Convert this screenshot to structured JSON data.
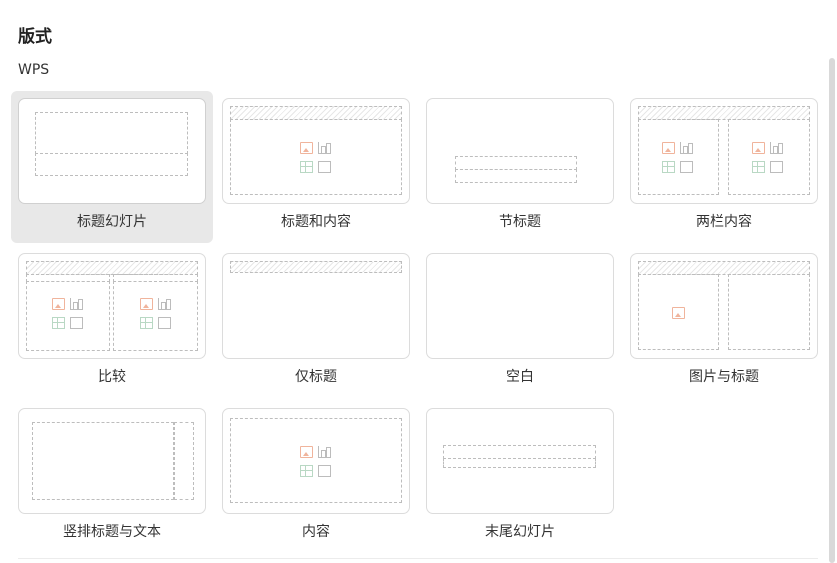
{
  "panel": {
    "title": "版式",
    "group_label": "WPS"
  },
  "layouts": [
    {
      "label": "标题幻灯片",
      "selected": true
    },
    {
      "label": "标题和内容",
      "selected": false
    },
    {
      "label": "节标题",
      "selected": false
    },
    {
      "label": "两栏内容",
      "selected": false
    },
    {
      "label": "比较",
      "selected": false
    },
    {
      "label": "仅标题",
      "selected": false
    },
    {
      "label": "空白",
      "selected": false
    },
    {
      "label": "图片与标题",
      "selected": false
    },
    {
      "label": "竖排标题与文本",
      "selected": false
    },
    {
      "label": "内容",
      "selected": false
    },
    {
      "label": "末尾幻灯片",
      "selected": false
    }
  ],
  "icons": {
    "placeholder_set": [
      "picture-icon",
      "chart-icon",
      "table-icon",
      "shape-icon"
    ]
  },
  "colors": {
    "selected_bg": "#e8e8e8",
    "thumb_border": "#dcdcdc",
    "placeholder_dash": "#bdbdbd",
    "picture_icon": "#f0b49c",
    "table_icon": "#b9d8c4"
  }
}
